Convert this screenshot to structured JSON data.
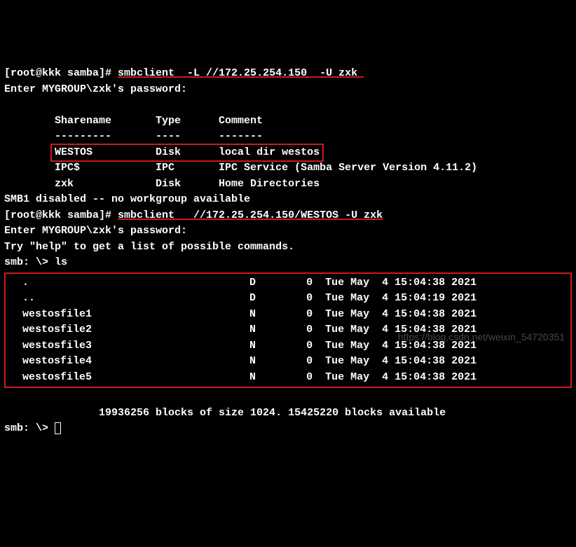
{
  "line1_prefix": "[root@kkk samba]# ",
  "line1_cmd": "smbclient  -L //172.25.254.150  -U zxk ",
  "password_prompt": "Enter MYGROUP\\zxk's password:",
  "header": "        Sharename       Type      Comment",
  "divider": "        ---------       ----      -------",
  "share_westos": "WESTOS          Disk      local dir westos",
  "share_ipc": "        IPC$            IPC       IPC Service (Samba Server Version 4.11.2)",
  "share_zxk": "        zxk             Disk      Home Directories",
  "smb1_line": "SMB1 disabled -- no workgroup available",
  "line2_prefix": "[root@kkk samba]# ",
  "line2_cmd": "smbclient   //172.25.254.150/WESTOS -U zxk",
  "try_help": "Try \"help\" to get a list of possible commands.",
  "smb_prompt_ls": "smb: \\> ls",
  "listing": [
    "  .                                   D        0  Tue May  4 15:04:38 2021",
    "  ..                                  D        0  Tue May  4 15:04:19 2021",
    "  westosfile1                         N        0  Tue May  4 15:04:38 2021",
    "  westosfile2                         N        0  Tue May  4 15:04:38 2021",
    "  westosfile3                         N        0  Tue May  4 15:04:38 2021",
    "  westosfile4                         N        0  Tue May  4 15:04:38 2021",
    "  westosfile5                         N        0  Tue May  4 15:04:38 2021"
  ],
  "blocks_line": "               19936256 blocks of size 1024. 15425220 blocks available",
  "smb_prompt_end": "smb: \\> ",
  "watermark": "https://blog.csdn.net/weixin_54720351"
}
